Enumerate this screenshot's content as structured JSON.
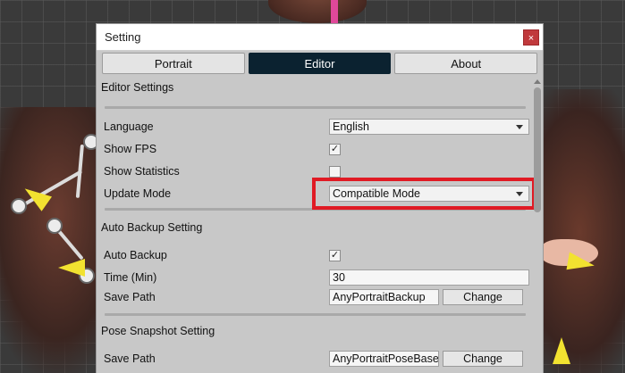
{
  "window": {
    "title": "Setting",
    "close_label": "×"
  },
  "tabs": [
    {
      "label": "Portrait",
      "active": false
    },
    {
      "label": "Editor",
      "active": true
    },
    {
      "label": "About",
      "active": false
    }
  ],
  "editor_settings": {
    "title": "Editor Settings",
    "language": {
      "label": "Language",
      "value": "English"
    },
    "show_fps": {
      "label": "Show FPS",
      "checked": true,
      "mark": "✓"
    },
    "show_statistics": {
      "label": "Show Statistics",
      "checked": false,
      "mark": ""
    },
    "update_mode": {
      "label": "Update Mode",
      "value": "Compatible Mode",
      "highlighted": true
    }
  },
  "auto_backup": {
    "title": "Auto Backup Setting",
    "auto_backup": {
      "label": "Auto Backup",
      "checked": true,
      "mark": "✓"
    },
    "time": {
      "label": "Time (Min)",
      "value": "30"
    },
    "save_path": {
      "label": "Save Path",
      "value": "AnyPortraitBackup",
      "button": "Change"
    }
  },
  "pose_snapshot": {
    "title": "Pose Snapshot Setting",
    "save_path": {
      "label": "Save Path",
      "value": "AnyPortraitPoseBase",
      "button": "Change"
    }
  },
  "colors": {
    "active_tab": "#0b2230",
    "highlight_border": "#e01a24",
    "close_button": "#c0393c"
  }
}
